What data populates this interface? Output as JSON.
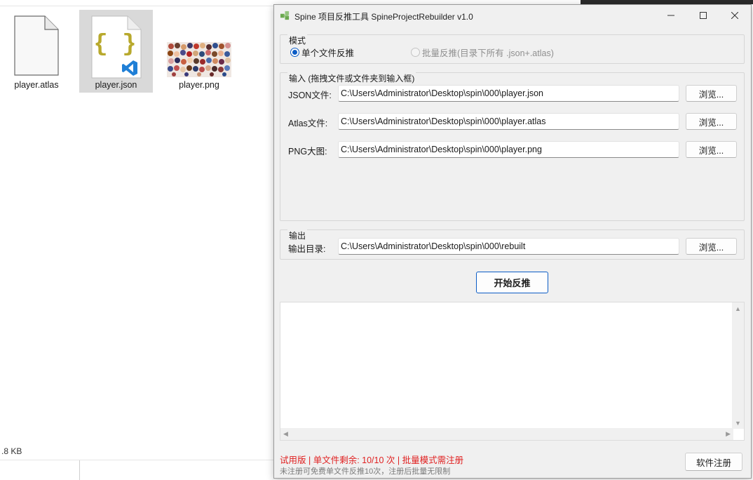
{
  "explorer": {
    "files": [
      {
        "name": "player.atlas",
        "icon": "blank-file-icon"
      },
      {
        "name": "player.json",
        "icon": "json-file-icon"
      },
      {
        "name": "player.png",
        "icon": "image-thumbnail"
      }
    ],
    "status_size": ".8 KB"
  },
  "window": {
    "title": "Spine 项目反推工具 SpineProjectRebuilder v1.0",
    "min_icon": "minimize-icon",
    "max_icon": "maximize-icon",
    "close_icon": "close-icon"
  },
  "mode": {
    "legend": "模式",
    "single": "单个文件反推",
    "batch": "批量反推(目录下所有 .json+.atlas)"
  },
  "input": {
    "legend": "输入 (拖拽文件或文件夹到输入框)",
    "json_label": "JSON文件:",
    "json_value": "C:\\Users\\Administrator\\Desktop\\spin\\000\\player.json",
    "atlas_label": "Atlas文件:",
    "atlas_value": "C:\\Users\\Administrator\\Desktop\\spin\\000\\player.atlas",
    "png_label": "PNG大图:",
    "png_value": "C:\\Users\\Administrator\\Desktop\\spin\\000\\player.png",
    "browse": "浏览..."
  },
  "output": {
    "legend": "输出",
    "dir_label": "输出目录:",
    "dir_value": "C:\\Users\\Administrator\\Desktop\\spin\\000\\rebuilt",
    "browse": "浏览..."
  },
  "actions": {
    "start": "开始反推",
    "register": "软件注册"
  },
  "status": {
    "line1": "试用版 | 单文件剩余: 10/10 次 | 批量模式需注册",
    "line2": "未注册可免费单文件反推10次，注册后批量无限制"
  },
  "colors": {
    "accent": "#0b5cc5",
    "status_red": "#e02020",
    "window_bg": "#f0f0f0"
  }
}
